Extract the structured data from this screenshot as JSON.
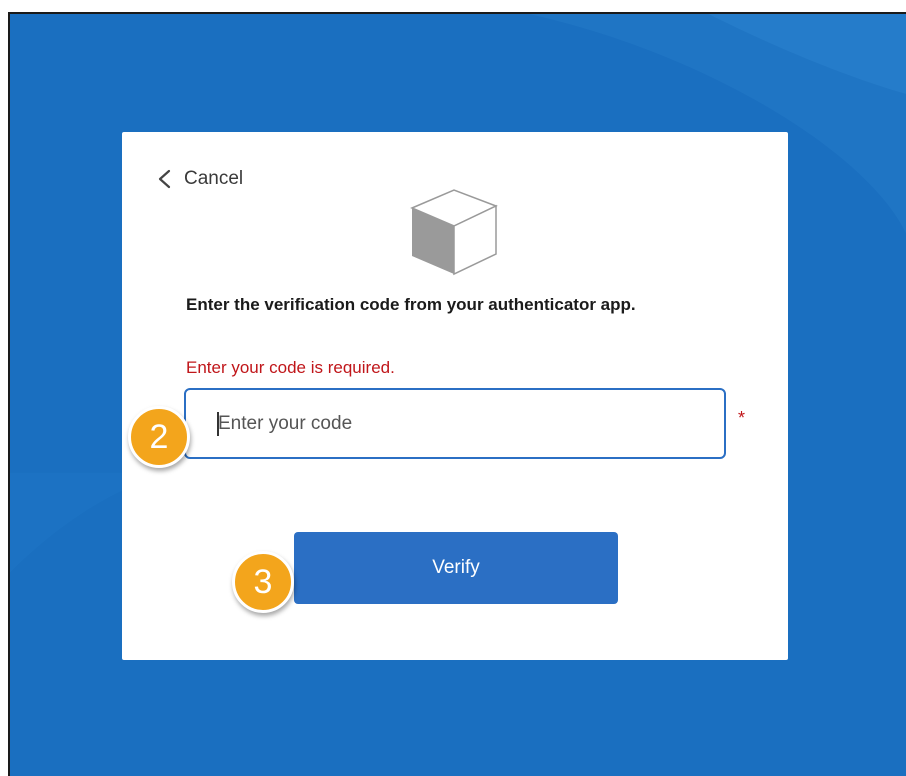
{
  "dialog": {
    "back_label": "Cancel",
    "heading": "Enter the verification code from your authenticator app.",
    "error_text": "Enter your code is required.",
    "code_input": {
      "value": "",
      "placeholder": "Enter your code"
    },
    "required_marker": "*",
    "verify_label": "Verify"
  },
  "annotations": {
    "step_input": "2",
    "step_verify": "3"
  },
  "icons": {
    "back": "chevron-left-icon",
    "app": "cube-icon"
  },
  "colors": {
    "background": "#1a6fc0",
    "accent": "#2b6fc4",
    "error": "#c0161a",
    "badge": "#f3a51c"
  }
}
